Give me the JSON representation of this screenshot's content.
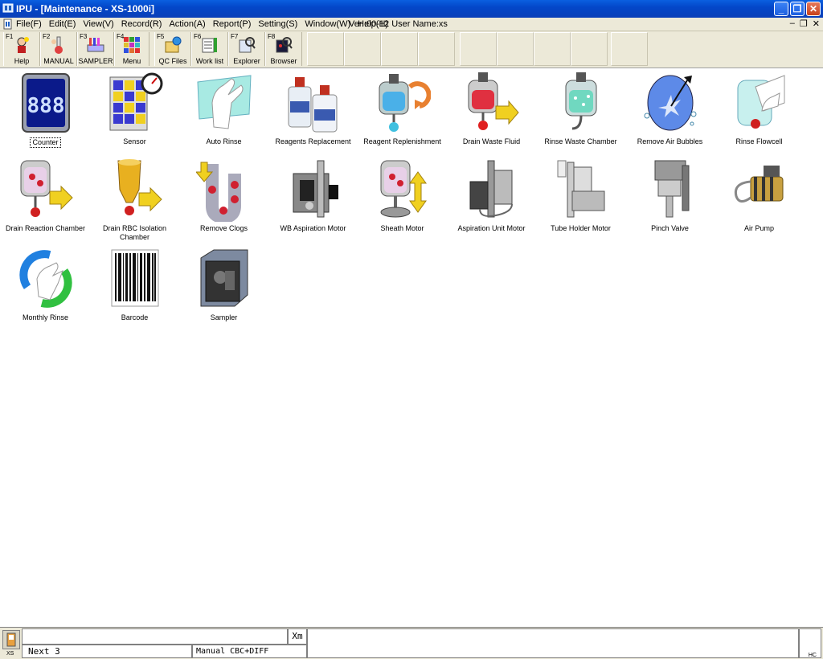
{
  "window": {
    "title": "IPU - [Maintenance - XS-1000i]"
  },
  "menubar": {
    "items": [
      "File(F)",
      "Edit(E)",
      "View(V)",
      "Record(R)",
      "Action(A)",
      "Report(P)",
      "Setting(S)",
      "Window(W)",
      "Help(H)"
    ],
    "info": "Ver.:00-12 User Name:xs"
  },
  "toolbar": {
    "buttons": [
      {
        "fkey": "F1",
        "label": "Help"
      },
      {
        "fkey": "F2",
        "label": "MANUAL"
      },
      {
        "fkey": "F3",
        "label": "SAMPLER"
      },
      {
        "fkey": "F4",
        "label": "Menu"
      },
      {
        "fkey": "F5",
        "label": "QC Files"
      },
      {
        "fkey": "F6",
        "label": "Work list"
      },
      {
        "fkey": "F7",
        "label": "Explorer"
      },
      {
        "fkey": "F8",
        "label": "Browser"
      }
    ]
  },
  "maintenance": {
    "items": [
      {
        "label": "Counter",
        "icon": "counter-icon"
      },
      {
        "label": "Sensor",
        "icon": "sensor-icon"
      },
      {
        "label": "Auto Rinse",
        "icon": "auto-rinse-icon"
      },
      {
        "label": "Reagents Replacement",
        "icon": "reagents-replacement-icon"
      },
      {
        "label": "Reagent Replenishment",
        "icon": "reagent-replenishment-icon"
      },
      {
        "label": "Drain Waste Fluid",
        "icon": "drain-waste-fluid-icon"
      },
      {
        "label": "Rinse Waste Chamber",
        "icon": "rinse-waste-chamber-icon"
      },
      {
        "label": "Remove Air Bubbles",
        "icon": "remove-air-bubbles-icon"
      },
      {
        "label": "Rinse Flowcell",
        "icon": "rinse-flowcell-icon"
      },
      {
        "label": "Drain Reaction Chamber",
        "icon": "drain-reaction-chamber-icon"
      },
      {
        "label": "Drain RBC Isolation Chamber",
        "icon": "drain-rbc-isolation-chamber-icon"
      },
      {
        "label": "Remove Clogs",
        "icon": "remove-clogs-icon"
      },
      {
        "label": "WB Aspiration Motor",
        "icon": "wb-aspiration-motor-icon"
      },
      {
        "label": "Sheath Motor",
        "icon": "sheath-motor-icon"
      },
      {
        "label": "Aspiration Unit Motor",
        "icon": "aspiration-unit-motor-icon"
      },
      {
        "label": "Tube Holder Motor",
        "icon": "tube-holder-motor-icon"
      },
      {
        "label": "Pinch Valve",
        "icon": "pinch-valve-icon"
      },
      {
        "label": "Air Pump",
        "icon": "air-pump-icon"
      },
      {
        "label": "Monthly Rinse",
        "icon": "monthly-rinse-icon"
      },
      {
        "label": "Barcode",
        "icon": "barcode-icon"
      },
      {
        "label": "Sampler",
        "icon": "sampler-icon"
      }
    ]
  },
  "statusbar": {
    "icon_label": "XS",
    "xm_label": "Xm",
    "next": "Next 3",
    "mode": "Manual CBC+DIFF",
    "corner": "HC"
  }
}
